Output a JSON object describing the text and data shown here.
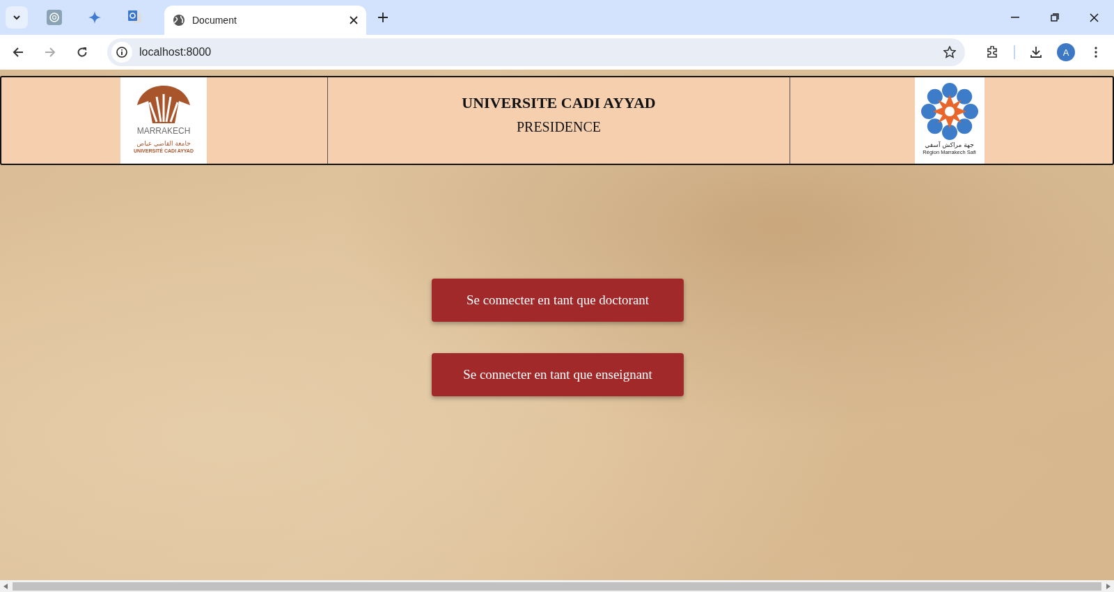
{
  "browser": {
    "tab_title": "Document",
    "address": "localhost:8000",
    "profile_initial": "A"
  },
  "header": {
    "left_logo": {
      "wordmark": "MARRAKECH",
      "arabic": "جامعة القاضي عياض",
      "latin": "UNIVERSITÉ CADI AYYAD"
    },
    "title": "UNIVERSITE CADI AYYAD",
    "subtitle": "PRESIDENCE",
    "right_logo": {
      "arabic": "جهة مراكش آسفي",
      "latin": "Région Marrakech Safi"
    }
  },
  "buttons": [
    "Se connecter en tant que doctorant",
    "Se connecter en tant que enseignant"
  ]
}
